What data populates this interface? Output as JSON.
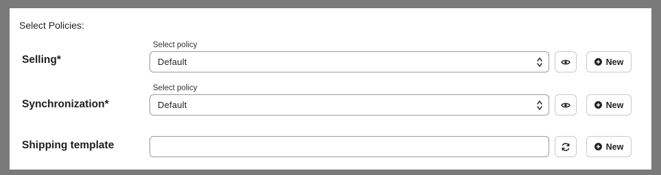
{
  "section": {
    "title": "Select Policies:"
  },
  "rows": [
    {
      "label": "Selling*",
      "caption": "Select policy",
      "value": "Default",
      "action_icon": "eye-icon",
      "new_label": "New"
    },
    {
      "label": "Synchronization*",
      "caption": "Select policy",
      "value": "Default",
      "action_icon": "eye-icon",
      "new_label": "New"
    },
    {
      "label": "Shipping template",
      "value": "",
      "action_icon": "refresh-icon",
      "new_label": "New"
    }
  ],
  "colors": {
    "backdrop": "#7a7a7a",
    "panel": "#ffffff",
    "border": "#9a9a9a",
    "text": "#222222"
  }
}
